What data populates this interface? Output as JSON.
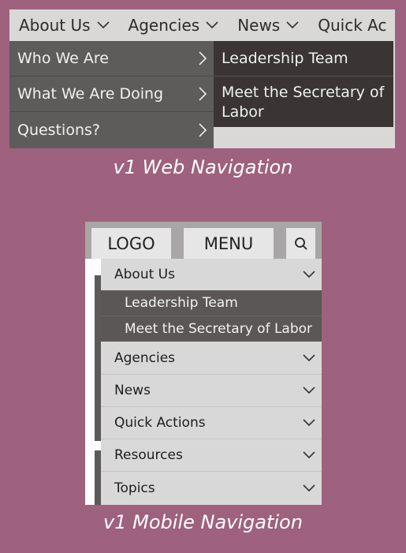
{
  "web_nav": {
    "top_items": [
      "About Us",
      "Agencies",
      "News",
      "Quick Ac"
    ],
    "submenu": [
      "Who We Are",
      "What We Are Doing",
      "Questions?"
    ],
    "flyout": [
      "Leadership Team",
      "Meet the Secretary of Labor"
    ],
    "caption": "v1 Web Navigation"
  },
  "mobile_nav": {
    "logo_label": "LOGO",
    "menu_label": "MENU",
    "expanded_item": "About Us",
    "sub_items": [
      "Leadership Team",
      "Meet the Secretary of Labor"
    ],
    "items": [
      "Agencies",
      "News",
      "Quick Actions",
      "Resources",
      "Topics"
    ],
    "caption": "v1 Mobile Navigation"
  },
  "colors": {
    "background": "#9e617e",
    "menu_dark": "#5e5b5b",
    "flyout_dark": "#3a3434",
    "bar_light": "#d9d8d7"
  },
  "icons": [
    "chevron-down-icon",
    "chevron-right-icon",
    "search-icon"
  ]
}
